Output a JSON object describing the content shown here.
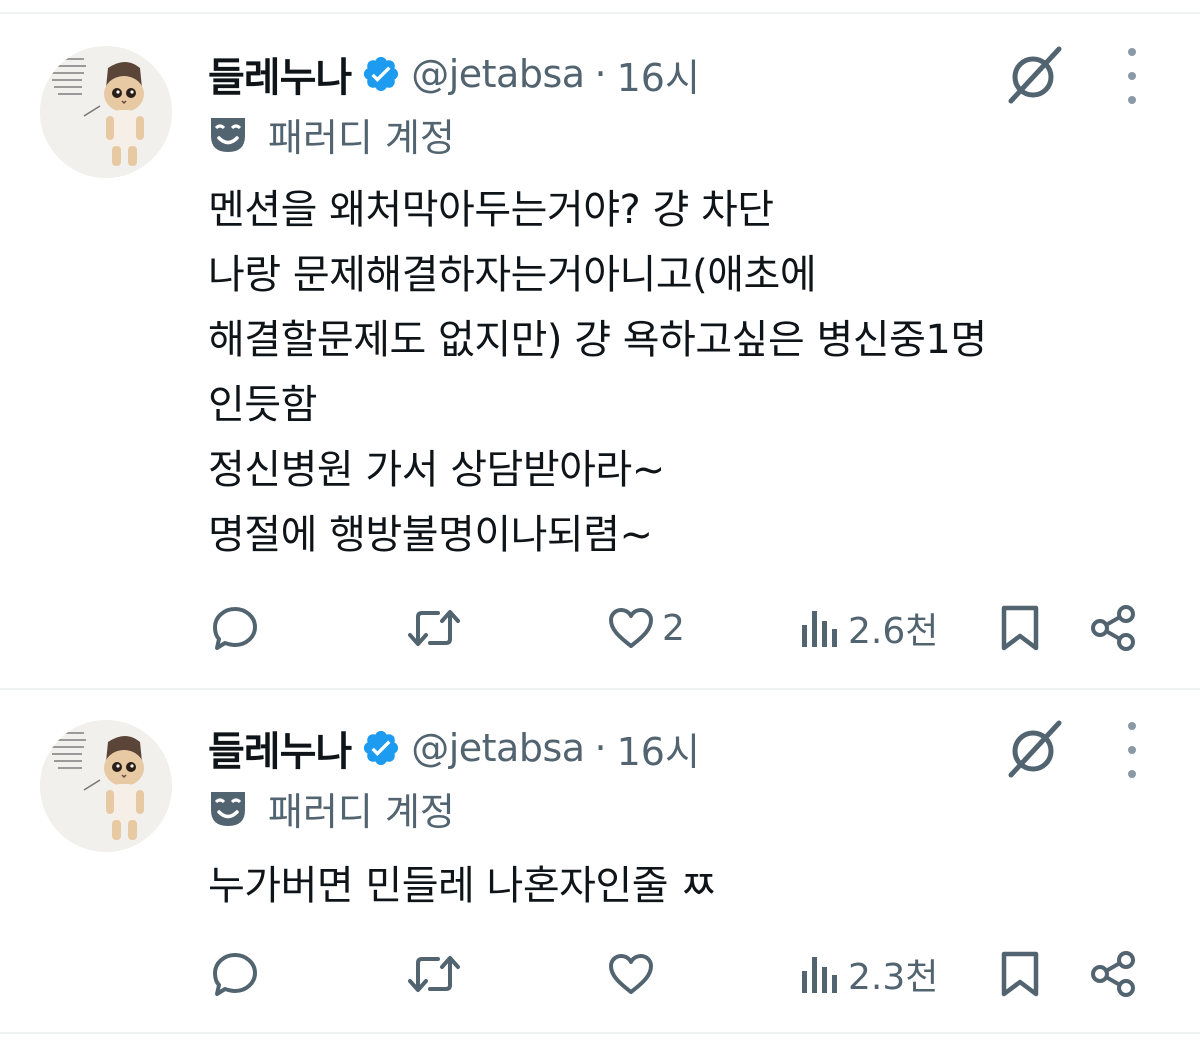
{
  "tweets": [
    {
      "author": {
        "display_name": "들레누나",
        "handle": "@jetabsa",
        "time": "16시",
        "verified": true,
        "avatar_icon": "cat-avatar-icon"
      },
      "label": "패러디 계정",
      "text_lines": [
        "멘션을 왜처막아두는거야? 걍 차단",
        "나랑 문제해결하자는거아니고(애초에",
        "해결할문제도 없지만) 걍 욕하고싶은 병신중1명",
        "인듯함",
        "정신병원 가서 상담받아라~",
        "명절에 행방불명이나되렴~"
      ],
      "actions": {
        "reply_count": "",
        "retweet_count": "",
        "like_count": "2",
        "views": "2.6천"
      }
    },
    {
      "author": {
        "display_name": "들레누나",
        "handle": "@jetabsa",
        "time": "16시",
        "verified": true,
        "avatar_icon": "cat-avatar-icon"
      },
      "label": "패러디 계정",
      "text_lines": [
        "누가버면 민들레 나혼자인줄 ㅉ"
      ],
      "actions": {
        "reply_count": "",
        "retweet_count": "",
        "like_count": "",
        "views": "2.3천"
      }
    }
  ],
  "separator": "·",
  "icons": {
    "verified": "verified-badge-icon",
    "grok": "grok-icon",
    "more": "more-options-icon",
    "parody": "parody-mask-icon",
    "reply": "reply-icon",
    "retweet": "retweet-icon",
    "like": "heart-icon",
    "views": "views-icon",
    "bookmark": "bookmark-icon",
    "share": "share-icon"
  },
  "colors": {
    "verified_blue": "#1d9bf0",
    "muted_text": "#536471",
    "border": "#eff3f4"
  }
}
